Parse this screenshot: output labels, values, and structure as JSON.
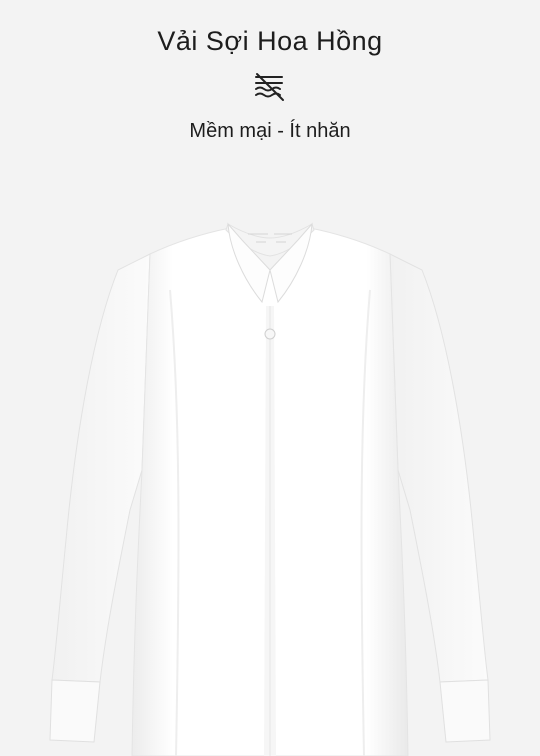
{
  "header": {
    "title": "Vải Sợi Hoa Hồng",
    "feature_icon": "no-wrinkle-fabric-icon",
    "subtitle": "Mềm mại - Ít nhăn"
  },
  "product_image": {
    "subject": "shirt-image",
    "color": "#ffffff",
    "background": "#f3f3f3"
  }
}
